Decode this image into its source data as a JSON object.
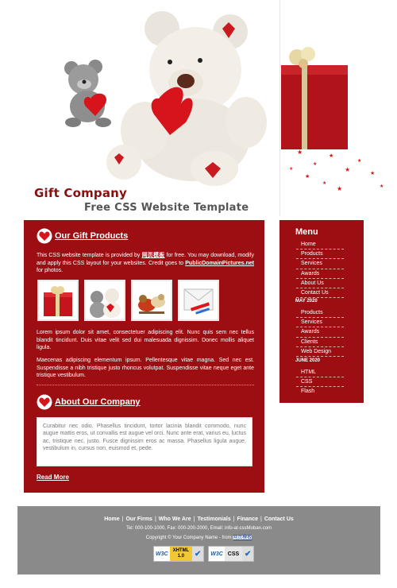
{
  "header": {
    "title": "Gift Company",
    "subtitle": "Free CSS Website Template"
  },
  "content": {
    "gift_products": {
      "heading": "Our Gift Products",
      "intro_1": "This CSS website template is provided by ",
      "intro_link_1": "网页模板",
      "intro_2": " for free. You may download, modify and apply this CSS layout for your websites. Credit goes to ",
      "intro_link_2": "PublicDomainPictures.net",
      "intro_3": " for photos.",
      "thumbnails": [
        "gift-box-thumb",
        "teddy-bears-thumb",
        "toy-animals-thumb",
        "gift-card-thumb"
      ],
      "paragraph_1": "Lorem ipsum dolor sit amet, consectetuer adipiscing elit. Nunc quis sem nec tellus blandit tincidunt. Duis vitae velit sed dui malesuada dignissim. Donec mollis aliquet ligula.",
      "paragraph_2": "Maecenas adipiscing elementum ipsum. Pellentesque vitae magna. Sed nec est. Suspendisse a nibh tristique justo rhoncus volutpat. Suspendisse vitae neque eget ante tristique vestibulum."
    },
    "about": {
      "heading": "About Our Company",
      "text": "Curabitur nec odio. Phasellus tincidunt, tortor lacinia blandit commodo, nunc augue mattis eros, ut convallis est augue vel orci. Nunc ante erat, varius eu, luctus ac, tristique nec, justo. Fusce dignissim eros ac massa. Phasellus ligula augue, vestibulum in, cursus non, euismod et, pede.",
      "read_more": "Read More"
    }
  },
  "sidebar": {
    "title": "Menu",
    "menu": [
      "Home",
      "Products",
      "Services",
      "Awards",
      "About Us",
      "Contact Us"
    ],
    "group_1": {
      "label": "MAY 2020",
      "items": [
        "Products",
        "Services",
        "Awards",
        "Clients",
        "Web Design"
      ]
    },
    "group_2": {
      "label": "JUNE 2020",
      "items": [
        "HTML",
        "CSS",
        "Flash"
      ]
    }
  },
  "footer": {
    "nav": [
      "Home",
      "Our Firms",
      "Who We Are",
      "Testimonials",
      "Finance",
      "Contact Us"
    ],
    "contact": "Tel: 000-100-1000, Fax: 000-200-2000, Email: info-at-cssMoban.com",
    "copyright": "Copyright © Your Company Name - from ",
    "copyright_link": "网页模板",
    "badge_xhtml": {
      "w3c": "W3C",
      "label": "XHTML",
      "version": "1.0"
    },
    "badge_css": {
      "w3c": "W3C",
      "label": "CSS"
    }
  },
  "colors": {
    "brand_red": "#9d0e12",
    "footer_gray": "#8a8a8a",
    "title_red": "#8a0f0f"
  }
}
